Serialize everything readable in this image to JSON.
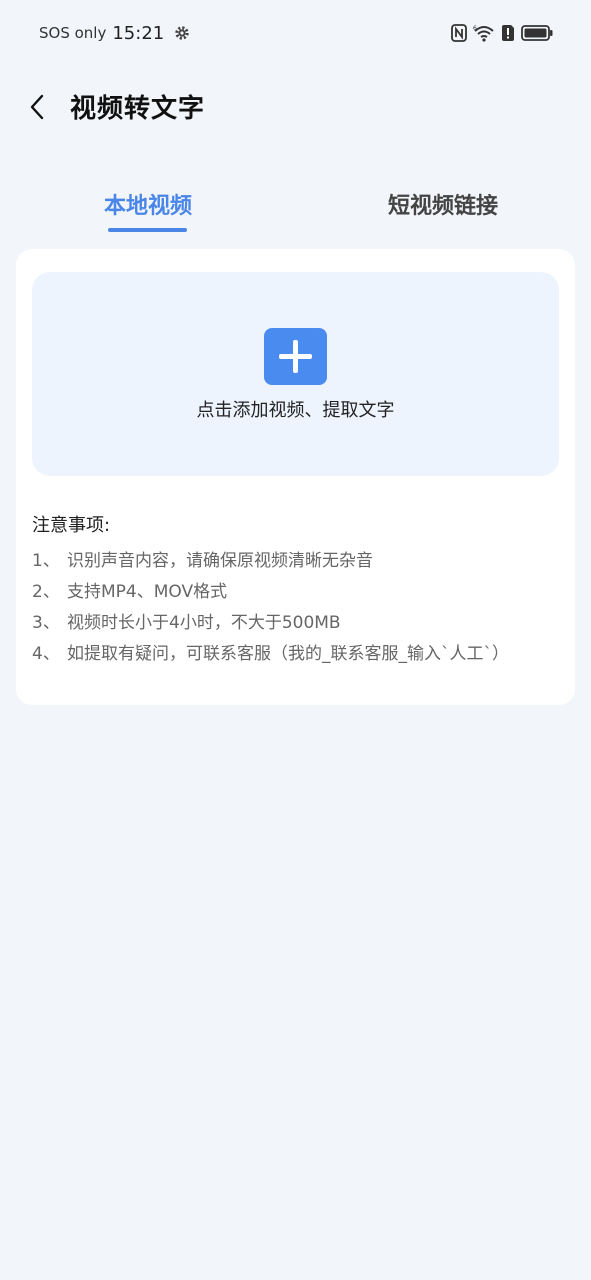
{
  "status_bar": {
    "carrier": "SOS only",
    "time": "15:21"
  },
  "header": {
    "title": "视频转文字"
  },
  "tabs": [
    {
      "label": "本地视频",
      "active": true
    },
    {
      "label": "短视频链接",
      "active": false
    }
  ],
  "upload": {
    "label": "点击添加视频、提取文字"
  },
  "notes": {
    "title": "注意事项:",
    "items": [
      {
        "num": "1、",
        "text": "识别声音内容，请确保原视频清晰无杂音"
      },
      {
        "num": "2、",
        "text": "支持MP4、MOV格式"
      },
      {
        "num": "3、",
        "text": "视频时长小于4小时，不大于500MB"
      },
      {
        "num": "4、",
        "text": "如提取有疑问，可联系客服（我的_联系客服_输入`人工`）"
      }
    ]
  },
  "colors": {
    "accent": "#4a86e8",
    "background": "#f2f5fa",
    "upload_bg": "#eef4fd"
  }
}
